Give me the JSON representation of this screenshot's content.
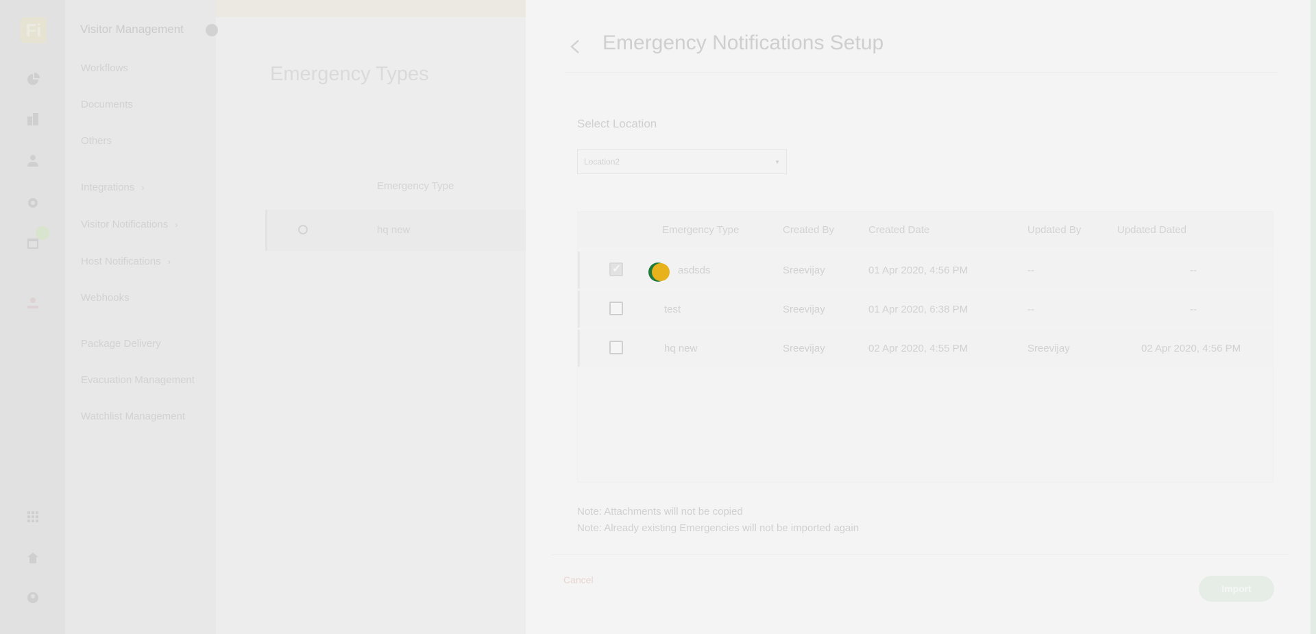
{
  "rail": {
    "logo_text": "Fi",
    "icons": [
      "analytics-icon",
      "building-icon",
      "user-add-icon",
      "settings-icon",
      "calendar-icon",
      "person-badge-icon",
      "apps-grid-icon",
      "home-icon",
      "account-icon"
    ]
  },
  "menu": {
    "title": "Visitor Management",
    "items": [
      {
        "label": "Workflows"
      },
      {
        "label": "Documents"
      },
      {
        "label": "Others"
      },
      {
        "label": "Integrations"
      },
      {
        "label": "Visitor Notifications"
      },
      {
        "label": "Host Notifications"
      },
      {
        "label": "Webhooks"
      },
      {
        "label": "Package Delivery"
      },
      {
        "label": "Evacuation Management"
      },
      {
        "label": "Watchlist Management"
      }
    ]
  },
  "background": {
    "title": "Emergency Types",
    "column_header": "Emergency Type",
    "row_value": "hq new"
  },
  "modal": {
    "title": "Emergency Notifications Setup",
    "location_label": "Select Location",
    "location_value": "Location2",
    "table": {
      "headers": [
        "Emergency Type",
        "Created By",
        "Created Date",
        "Updated By",
        "Updated Dated"
      ],
      "rows": [
        {
          "type": "asdsds",
          "created_by": "Sreevijay",
          "created_date": "01 Apr 2020, 4:56 PM",
          "updated_by": "--",
          "updated_date": "--",
          "checked": true
        },
        {
          "type": "test",
          "created_by": "Sreevijay",
          "created_date": "01 Apr 2020, 6:38 PM",
          "updated_by": "--",
          "updated_date": "--",
          "checked": false
        },
        {
          "type": "hq new",
          "created_by": "Sreevijay",
          "created_date": "02 Apr 2020, 4:55 PM",
          "updated_by": "Sreevijay",
          "updated_date": "02 Apr 2020, 4:56 PM",
          "checked": false
        }
      ]
    },
    "notes": [
      "Note: Attachments will not be copied",
      "Note: Already existing Emergencies will not be imported again"
    ],
    "cancel_label": "Cancel",
    "import_label": "Import"
  },
  "colors": {
    "loader_green": "#1e7a3d",
    "loader_yellow": "#e8b21c"
  }
}
